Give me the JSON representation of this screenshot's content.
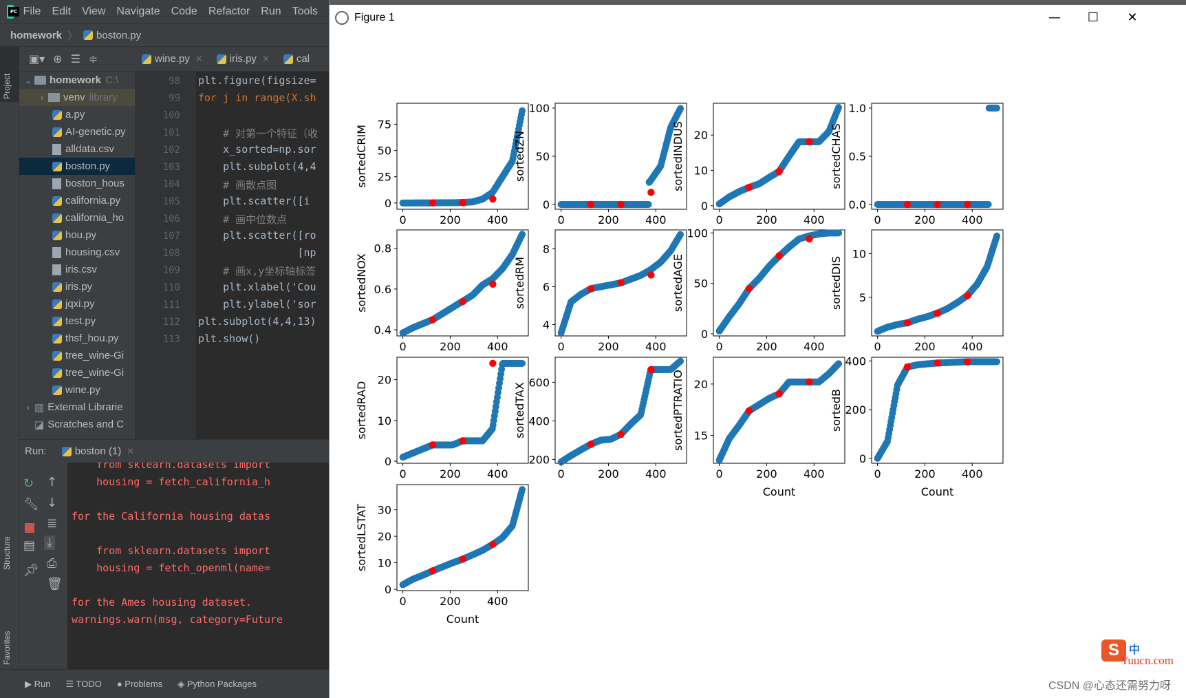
{
  "ide": {
    "menu": [
      "File",
      "Edit",
      "View",
      "Navigate",
      "Code",
      "Refactor",
      "Run",
      "Tools"
    ],
    "breadcrumb": [
      "homework",
      "boston.py"
    ],
    "side_tabs": [
      "Project",
      "Structure",
      "Favorites"
    ],
    "project_tree": {
      "root": "homework",
      "root_path": "C:\\",
      "venv": "venv",
      "venv_hint": "library",
      "files": [
        "a.py",
        "AI-genetic.py",
        "alldata.csv",
        "boston.py",
        "boston_hous",
        "california.py",
        "california_ho",
        "hou.py",
        "housing.csv",
        "iris.csv",
        "iris.py",
        "jqxi.py",
        "test.py",
        "thsf_hou.py",
        "tree_wine-Gi",
        "tree_wine-Gi",
        "wine.py"
      ],
      "selected": "boston.py",
      "external": "External Librarie",
      "scratches": "Scratches and C"
    },
    "editor_tabs": [
      "wine.py",
      "iris.py",
      "cal"
    ],
    "line_numbers": [
      "98",
      "99",
      "100",
      "101",
      "102",
      "103",
      "104",
      "105",
      "106",
      "107",
      "108",
      "109",
      "110",
      "111",
      "112",
      "113"
    ],
    "code_lines": [
      "plt.figure(figsize=",
      "for j in range(X.sh",
      "",
      "    # 对第一个特征（收",
      "    x_sorted=np.sor",
      "    plt.subplot(4,4",
      "    # 画散点图",
      "    plt.scatter([i ",
      "    # 画中位数点",
      "    plt.scatter([ro",
      "                [np",
      "    # 画x,y坐标轴标签",
      "    plt.xlabel('Cou",
      "    plt.ylabel('sor",
      "plt.subplot(4,4,13)",
      "plt.show()"
    ],
    "run": {
      "label": "Run:",
      "tab": "boston (1)",
      "output": [
        "    from sklearn.datasets import",
        "    housing = fetch_california_h",
        "",
        "for the California housing datas",
        "",
        "    from sklearn.datasets import",
        "    housing = fetch_openml(name=",
        "",
        "for the Ames housing dataset.",
        "warnings.warn(msg, category=Future"
      ]
    },
    "bottom_tabs": [
      "Run",
      "TODO",
      "Problems",
      "Python Packages"
    ]
  },
  "figure": {
    "window_title": "Figure 1",
    "controls": [
      "—",
      "☐",
      "✕"
    ],
    "marker_color": "#1f77b4",
    "median_color": "#ff0000",
    "watermark": "CSDN @心态还需努力呀",
    "site_logo": "S",
    "site_text": "Yuucn.com",
    "site_badge": "中"
  },
  "chart_data": [
    {
      "type": "scatter",
      "ylabel": "sortedCRIM",
      "xlabel": "",
      "xticks": [
        "0",
        "200",
        "400"
      ],
      "yticks": [
        "0",
        "25",
        "50",
        "75"
      ],
      "ylim": [
        -6,
        95
      ],
      "xlim": [
        -25,
        530
      ],
      "y_curve": [
        0.006,
        0.02,
        0.05,
        0.1,
        0.2,
        0.26,
        0.5,
        1.0,
        3.7,
        10,
        25,
        40,
        89
      ],
      "medians": [
        [
          126,
          0.08
        ],
        [
          253,
          0.26
        ],
        [
          380,
          3.68
        ]
      ]
    },
    {
      "type": "scatter",
      "ylabel": "sortedZN",
      "xlabel": "",
      "xticks": [
        "0",
        "200",
        "400"
      ],
      "yticks": [
        "0",
        "50",
        "100"
      ],
      "ylim": [
        -5,
        105
      ],
      "xlim": [
        -25,
        530
      ],
      "y_curve": [
        0,
        0,
        0,
        0,
        0,
        0,
        0,
        0,
        12.5,
        25,
        40,
        80,
        100
      ],
      "medians": [
        [
          126,
          0
        ],
        [
          253,
          0
        ],
        [
          380,
          12.5
        ]
      ]
    },
    {
      "type": "scatter",
      "ylabel": "sortedINDUS",
      "xlabel": "",
      "xticks": [
        "0",
        "200",
        "400"
      ],
      "yticks": [
        "0",
        "10",
        "20"
      ],
      "ylim": [
        -1,
        29
      ],
      "xlim": [
        -25,
        530
      ],
      "y_curve": [
        0.5,
        2.5,
        4,
        5.2,
        6.2,
        8,
        9.7,
        14,
        18.1,
        18.1,
        18.1,
        21,
        28
      ],
      "medians": [
        [
          126,
          5.2
        ],
        [
          253,
          9.7
        ],
        [
          380,
          18.1
        ]
      ]
    },
    {
      "type": "scatter",
      "ylabel": "sortedCHAS",
      "xlabel": "",
      "xticks": [
        "0",
        "200",
        "400"
      ],
      "yticks": [
        "0.0",
        "0.5",
        "1.0"
      ],
      "ylim": [
        -0.05,
        1.05
      ],
      "xlim": [
        -25,
        530
      ],
      "y_curve": [
        0,
        0,
        0,
        0,
        0,
        0,
        0,
        0,
        0,
        0,
        0,
        0,
        1
      ],
      "medians": [
        [
          126,
          0
        ],
        [
          253,
          0
        ],
        [
          380,
          0
        ]
      ]
    },
    {
      "type": "scatter",
      "ylabel": "sortedNOX",
      "xlabel": "",
      "xticks": [
        "0",
        "200",
        "400"
      ],
      "yticks": [
        "0.4",
        "0.6",
        "0.8"
      ],
      "ylim": [
        0.37,
        0.89
      ],
      "xlim": [
        -25,
        530
      ],
      "y_curve": [
        0.385,
        0.41,
        0.43,
        0.45,
        0.48,
        0.51,
        0.54,
        0.57,
        0.62,
        0.65,
        0.7,
        0.77,
        0.871
      ],
      "medians": [
        [
          126,
          0.449
        ],
        [
          253,
          0.538
        ],
        [
          380,
          0.624
        ]
      ]
    },
    {
      "type": "scatter",
      "ylabel": "sortedRM",
      "xlabel": "",
      "xticks": [
        "0",
        "200",
        "400"
      ],
      "yticks": [
        "4",
        "6",
        "8"
      ],
      "ylim": [
        3.4,
        9.0
      ],
      "xlim": [
        -25,
        530
      ],
      "y_curve": [
        3.56,
        5.2,
        5.6,
        5.9,
        6.0,
        6.1,
        6.2,
        6.4,
        6.6,
        6.9,
        7.3,
        7.9,
        8.78
      ],
      "medians": [
        [
          126,
          5.89
        ],
        [
          253,
          6.21
        ],
        [
          380,
          6.62
        ]
      ]
    },
    {
      "type": "scatter",
      "ylabel": "sortedAGE",
      "xlabel": "",
      "xticks": [
        "0",
        "200",
        "400"
      ],
      "yticks": [
        "0",
        "50",
        "100"
      ],
      "ylim": [
        -2,
        103
      ],
      "xlim": [
        -25,
        530
      ],
      "y_curve": [
        2.9,
        17,
        30,
        45,
        55,
        67,
        77,
        86,
        94,
        97,
        99,
        100,
        100
      ],
      "medians": [
        [
          126,
          45
        ],
        [
          253,
          77.5
        ],
        [
          380,
          94
        ]
      ]
    },
    {
      "type": "scatter",
      "ylabel": "sortedDIS",
      "xlabel": "",
      "xticks": [
        "0",
        "200",
        "400"
      ],
      "yticks": [
        "5",
        "10"
      ],
      "ylim": [
        0.6,
        12.7
      ],
      "xlim": [
        -25,
        530
      ],
      "y_curve": [
        1.13,
        1.6,
        1.9,
        2.1,
        2.5,
        2.8,
        3.2,
        3.7,
        4.4,
        5.2,
        6.5,
        8.5,
        12.1
      ],
      "medians": [
        [
          126,
          2.1
        ],
        [
          253,
          3.2
        ],
        [
          380,
          5.19
        ]
      ]
    },
    {
      "type": "scatter",
      "ylabel": "sortedRAD",
      "xlabel": "",
      "xticks": [
        "0",
        "200",
        "400"
      ],
      "yticks": [
        "0",
        "10",
        "20"
      ],
      "ylim": [
        -0.5,
        25.5
      ],
      "xlim": [
        -25,
        530
      ],
      "y_curve": [
        1,
        2,
        3,
        4,
        4,
        4,
        5,
        5,
        5,
        8,
        24,
        24,
        24
      ],
      "medians": [
        [
          126,
          4
        ],
        [
          253,
          5
        ],
        [
          380,
          24
        ]
      ]
    },
    {
      "type": "scatter",
      "ylabel": "sortedTAX",
      "xlabel": "",
      "xticks": [
        "0",
        "200",
        "400"
      ],
      "yticks": [
        "200",
        "400",
        "600"
      ],
      "ylim": [
        180,
        730
      ],
      "xlim": [
        -25,
        530
      ],
      "y_curve": [
        187,
        220,
        250,
        279,
        300,
        305,
        330,
        384,
        432,
        666,
        666,
        666,
        711
      ],
      "medians": [
        [
          126,
          279
        ],
        [
          253,
          330
        ],
        [
          380,
          666
        ]
      ]
    },
    {
      "type": "scatter",
      "ylabel": "sortedPTRATIO",
      "xlabel": "Count",
      "xticks": [
        "0",
        "200",
        "400"
      ],
      "yticks": [
        "15",
        "20"
      ],
      "ylim": [
        12.3,
        22.6
      ],
      "xlim": [
        -25,
        530
      ],
      "y_curve": [
        12.6,
        14.7,
        16,
        17.4,
        18,
        18.6,
        19.05,
        20.2,
        20.2,
        20.2,
        20.2,
        21,
        22
      ],
      "medians": [
        [
          126,
          17.4
        ],
        [
          253,
          19.05
        ],
        [
          380,
          20.2
        ]
      ]
    },
    {
      "type": "scatter",
      "ylabel": "sortedB",
      "xlabel": "Count",
      "xticks": [
        "0",
        "200",
        "400"
      ],
      "yticks": [
        "0",
        "200",
        "400"
      ],
      "ylim": [
        -20,
        415
      ],
      "xlim": [
        -25,
        530
      ],
      "y_curve": [
        0.3,
        70,
        300,
        375.3,
        384,
        388,
        391.4,
        393,
        395,
        396.9,
        396.9,
        396.9,
        396.9
      ],
      "medians": [
        [
          126,
          375.3
        ],
        [
          253,
          391.4
        ],
        [
          380,
          396.2
        ]
      ]
    },
    {
      "type": "scatter",
      "ylabel": "sortedLSTAT",
      "xlabel": "Count",
      "xticks": [
        "0",
        "200",
        "400"
      ],
      "yticks": [
        "0",
        "10",
        "20",
        "30"
      ],
      "ylim": [
        -0.5,
        39.5
      ],
      "xlim": [
        -25,
        530
      ],
      "y_curve": [
        1.73,
        3.8,
        5.3,
        6.95,
        8.5,
        10,
        11.36,
        13,
        14.7,
        16.9,
        19.5,
        24,
        37.97
      ],
      "medians": [
        [
          126,
          6.95
        ],
        [
          253,
          11.36
        ],
        [
          380,
          16.96
        ]
      ]
    }
  ]
}
